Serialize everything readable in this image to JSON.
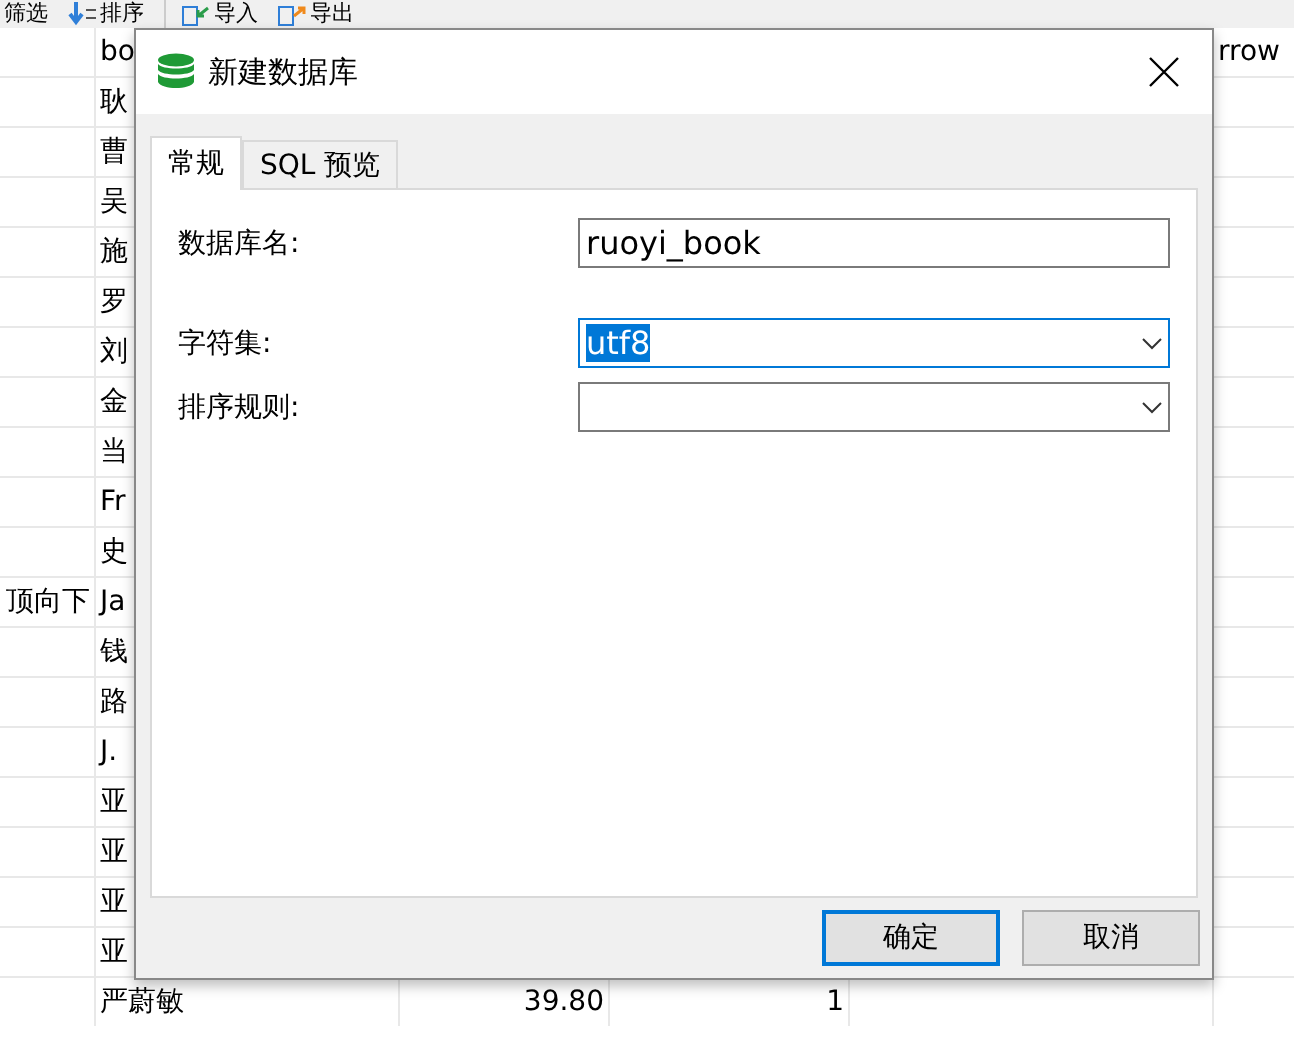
{
  "toolbar": [
    {
      "label": "筛选"
    },
    {
      "label": "排序"
    },
    {
      "label": "导入"
    },
    {
      "label": "导出"
    }
  ],
  "table": {
    "header": {
      "column_2": "bo",
      "column_6": "rrow"
    },
    "rows": [
      {
        "column_2": "耿"
      },
      {
        "column_2": "曹"
      },
      {
        "column_2": "吴"
      },
      {
        "column_2": "施"
      },
      {
        "column_2": "罗"
      },
      {
        "column_2": "刘"
      },
      {
        "column_2": "金"
      },
      {
        "column_2": "当"
      },
      {
        "column_2": "Fr"
      },
      {
        "column_2": "史"
      },
      {
        "column_1": "顶向下",
        "column_2": "Ja"
      },
      {
        "column_2": "钱"
      },
      {
        "column_2": "路"
      },
      {
        "column_2": "J."
      },
      {
        "column_2": "亚"
      },
      {
        "column_2": "亚"
      },
      {
        "column_2": "亚"
      },
      {
        "column_2": "亚"
      },
      {
        "column_2": "严蔚敏",
        "column_3": "39.80",
        "column_4": "1"
      }
    ]
  },
  "dialog": {
    "title": "新建数据库",
    "tabs": [
      {
        "label": "常规",
        "selected": true
      },
      {
        "label": "SQL 预览",
        "selected": false
      }
    ],
    "fields": [
      {
        "kind": "text",
        "label": "数据库名:",
        "value": "ruoyi_book",
        "focused": false
      },
      {
        "kind": "select",
        "label": "字符集:",
        "value": "utf8",
        "focused": true
      },
      {
        "kind": "select",
        "label": "排序规则:",
        "focused": false
      }
    ],
    "buttons": [
      {
        "label": "确定",
        "default": true
      },
      {
        "label": "取消",
        "default": false
      }
    ]
  }
}
